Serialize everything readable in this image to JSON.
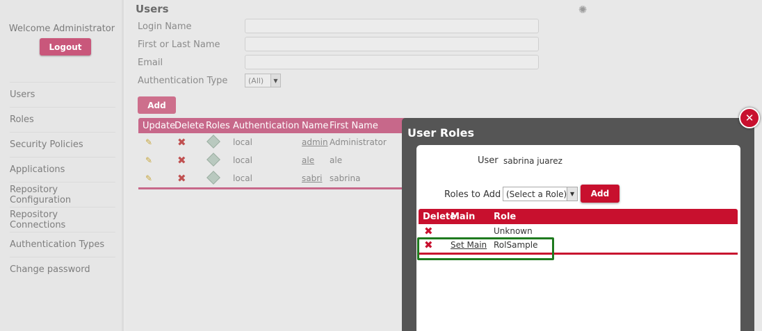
{
  "sidebar": {
    "welcome": "Welcome Administrator",
    "logout_label": "Logout",
    "items": [
      {
        "label": "Users"
      },
      {
        "label": "Roles"
      },
      {
        "label": "Security Policies"
      },
      {
        "label": "Applications"
      },
      {
        "label": "Repository Configuration"
      },
      {
        "label": "Repository Connections"
      },
      {
        "label": "Authentication Types"
      },
      {
        "label": "Change password"
      }
    ]
  },
  "main": {
    "title": "Users",
    "filters": {
      "login_name_label": "Login Name",
      "name_label": "First or Last Name",
      "email_label": "Email",
      "auth_type_label": "Authentication Type",
      "auth_type_value": "(All)"
    },
    "add_label": "Add",
    "table": {
      "headers": [
        "Update",
        "Delete",
        "Roles",
        "Authentication",
        "Name",
        "First Name"
      ],
      "rows": [
        {
          "authentication": "local",
          "name": "admin",
          "first_name": "Administrator"
        },
        {
          "authentication": "local",
          "name": "ale",
          "first_name": "ale"
        },
        {
          "authentication": "local",
          "name": "sabri",
          "first_name": "sabrina"
        }
      ]
    }
  },
  "modal": {
    "title": "User Roles",
    "user_label": "User",
    "user_value": "sabrina juarez",
    "roles_to_add_label": "Roles to Add",
    "role_select_value": "(Select a Role)",
    "add_label": "Add",
    "table": {
      "headers": [
        "Delete",
        "Main",
        "Role"
      ],
      "rows": [
        {
          "main": "",
          "role": "Unknown"
        },
        {
          "main": "Set Main",
          "role": "RolSample"
        }
      ]
    }
  },
  "colors": {
    "accent": "#c8102e",
    "accent_dimmed": "#c9577b",
    "highlight": "#1e7a1e"
  },
  "icons": {
    "update": "pencil-icon",
    "delete": "red-x-icon",
    "roles": "roles-icon",
    "close": "close-icon",
    "loading": "spinner-icon"
  }
}
